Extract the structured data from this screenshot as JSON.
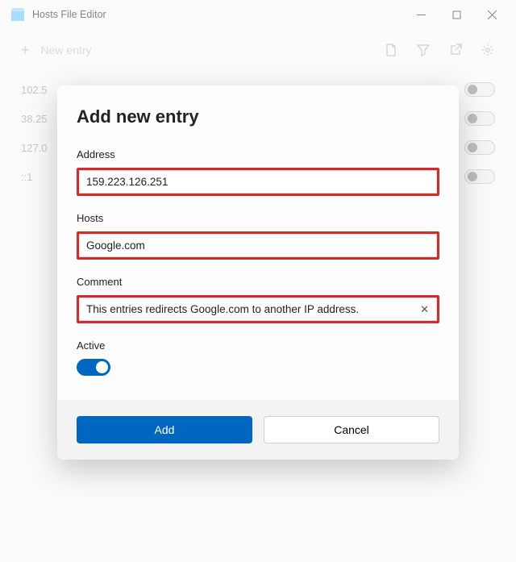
{
  "window": {
    "title": "Hosts File Editor"
  },
  "toolbar": {
    "new_entry_label": "New entry"
  },
  "entries": [
    {
      "ip": "102.5"
    },
    {
      "ip": "38.25"
    },
    {
      "ip": "127.0"
    },
    {
      "ip": "::1"
    }
  ],
  "dialog": {
    "title": "Add new entry",
    "address_label": "Address",
    "address_value": "159.223.126.251",
    "hosts_label": "Hosts",
    "hosts_value": "Google.com",
    "comment_label": "Comment",
    "comment_value": "This entries redirects Google.com to another IP address.",
    "active_label": "Active",
    "add_button": "Add",
    "cancel_button": "Cancel"
  }
}
